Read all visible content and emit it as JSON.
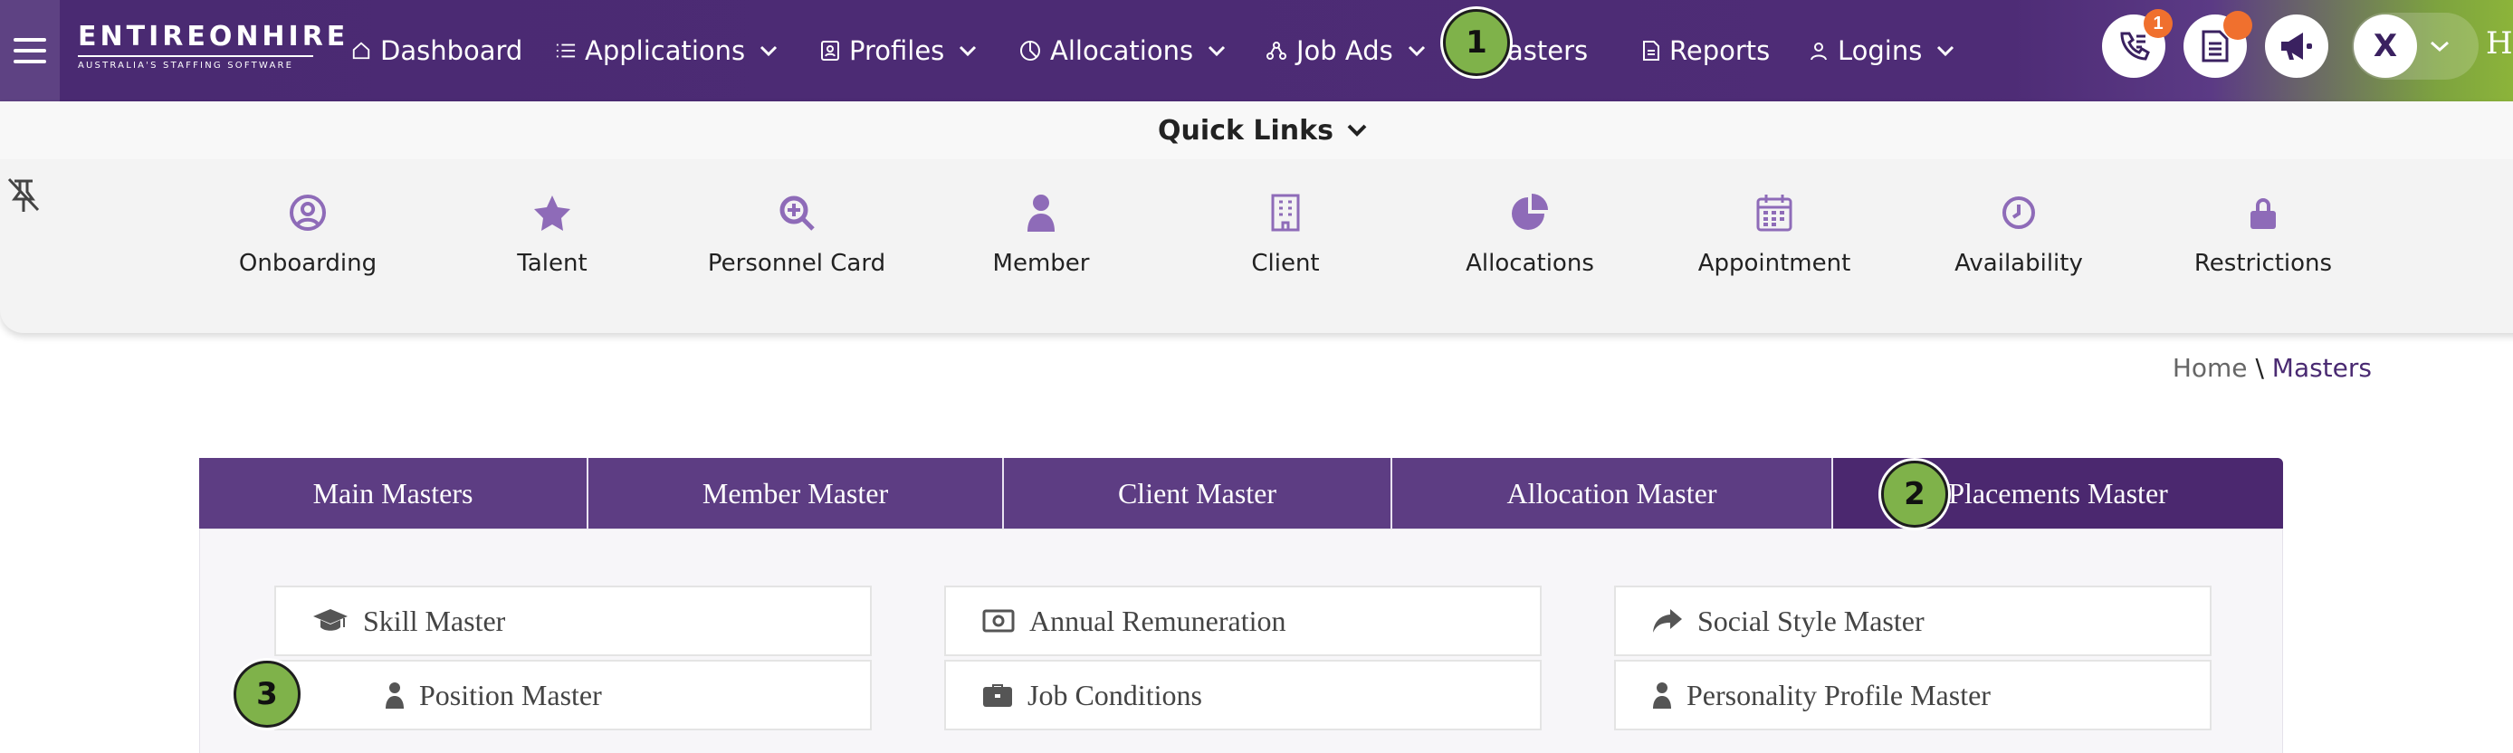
{
  "brand": {
    "name": "ENTIREONHIRE",
    "tagline": "AUSTRALIA'S STAFFING SOFTWARE"
  },
  "nav": {
    "items": [
      {
        "label": "Dashboard",
        "icon": "home-icon"
      },
      {
        "label": "Applications",
        "icon": "list-icon",
        "has_menu": true
      },
      {
        "label": "Profiles",
        "icon": "id-card-icon",
        "has_menu": true
      },
      {
        "label": "Allocations",
        "icon": "pie-icon",
        "has_menu": true
      },
      {
        "label": "Job Ads",
        "icon": "network-icon",
        "has_menu": true
      },
      {
        "label": "Masters"
      },
      {
        "label": "Reports",
        "icon": "document-icon"
      },
      {
        "label": "Logins",
        "icon": "user-icon",
        "has_menu": true
      }
    ],
    "call_badge": "1",
    "avatar_initial": "X",
    "cut_text": "He"
  },
  "quick_links": {
    "title": "Quick Links",
    "items": [
      {
        "label": "Onboarding",
        "icon": "user-circle-icon"
      },
      {
        "label": "Talent",
        "icon": "star-icon"
      },
      {
        "label": "Personnel Card",
        "icon": "search-plus-icon"
      },
      {
        "label": "Member",
        "icon": "person-icon"
      },
      {
        "label": "Client",
        "icon": "building-icon"
      },
      {
        "label": "Allocations",
        "icon": "pie-chart-icon"
      },
      {
        "label": "Appointment",
        "icon": "calendar-icon"
      },
      {
        "label": "Availability",
        "icon": "clock-icon"
      },
      {
        "label": "Restrictions",
        "icon": "lock-icon"
      }
    ]
  },
  "breadcrumb": {
    "home": "Home",
    "separator": "\\",
    "current": "Masters"
  },
  "tabs": [
    "Main Masters",
    "Member Master",
    "Client Master",
    "Allocation Master",
    "Placements Master"
  ],
  "masters": [
    {
      "label": "Skill Master",
      "icon": "graduation-cap-icon"
    },
    {
      "label": "Annual Remuneration",
      "icon": "money-bill-icon"
    },
    {
      "label": "Social Style Master",
      "icon": "share-arrow-icon"
    },
    {
      "label": "Position Master",
      "icon": "person-icon"
    },
    {
      "label": "Job Conditions",
      "icon": "briefcase-icon"
    },
    {
      "label": "Personality Profile Master",
      "icon": "person-icon"
    }
  ],
  "markers": [
    "1",
    "2",
    "3"
  ],
  "colors": {
    "nav_purple": "#4a2a72",
    "tab_purple": "#5d3d83",
    "icon_purple": "#8e6bb8",
    "marker_green": "#7fb24a",
    "badge_orange": "#f0702e"
  }
}
